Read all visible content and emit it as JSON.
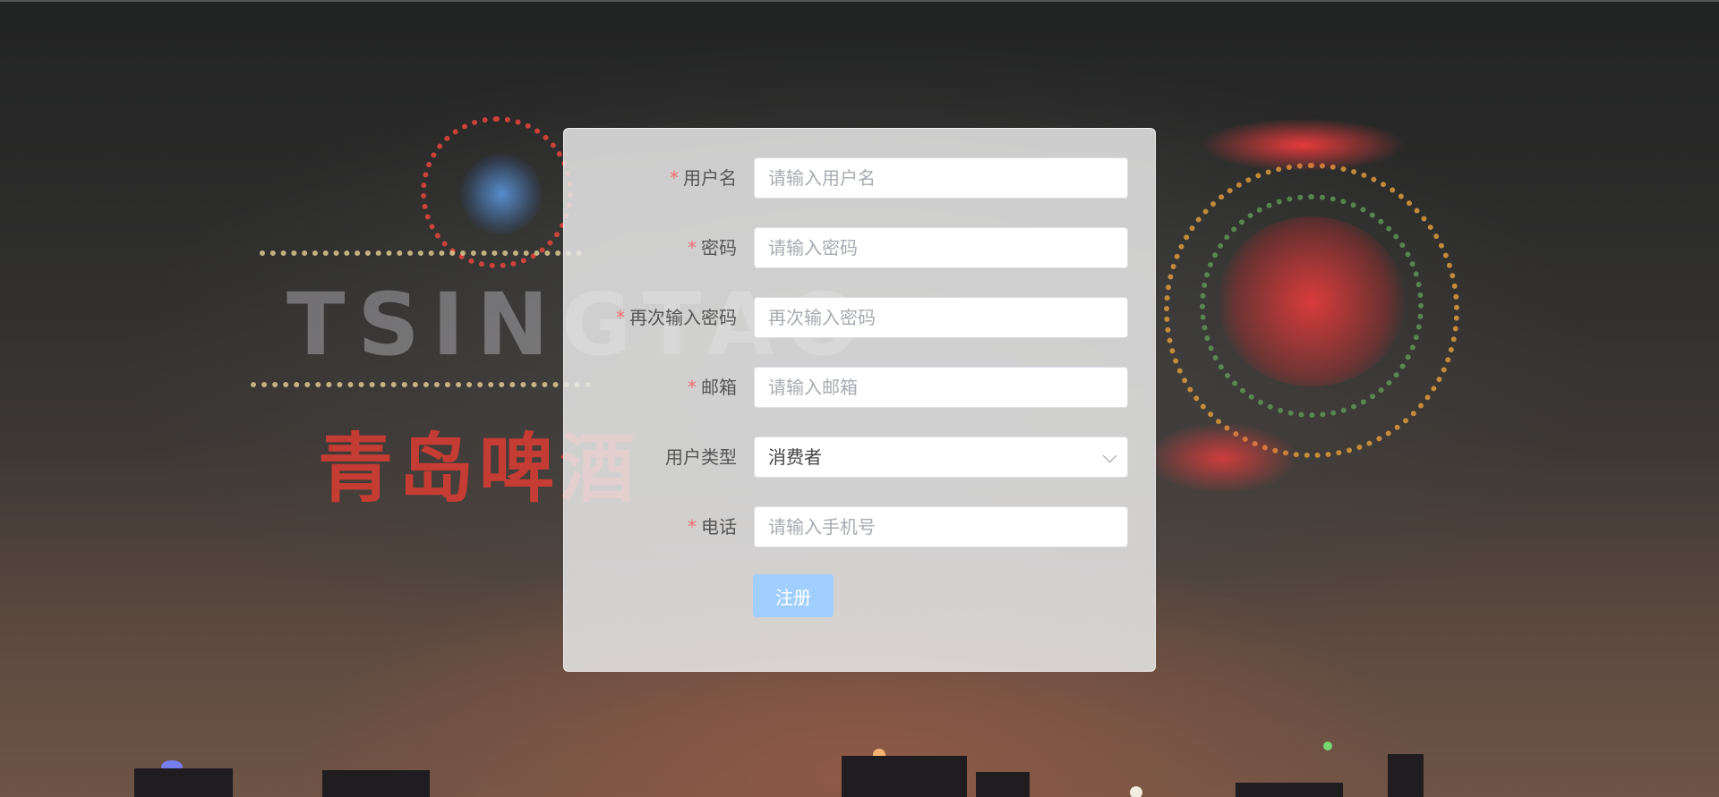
{
  "form": {
    "fields": [
      {
        "label": "用户名",
        "required": true,
        "type": "text",
        "placeholder": "请输入用户名"
      },
      {
        "label": "密码",
        "required": true,
        "type": "password",
        "placeholder": "请输入密码"
      },
      {
        "label": "再次输入密码",
        "required": true,
        "type": "password",
        "placeholder": "再次输入密码"
      },
      {
        "label": "邮箱",
        "required": true,
        "type": "text",
        "placeholder": "请输入邮箱"
      },
      {
        "label": "用户类型",
        "required": false,
        "type": "select",
        "value": "消费者",
        "icon": "chevron-down-icon"
      },
      {
        "label": "电话",
        "required": true,
        "type": "text",
        "placeholder": "请输入手机号"
      }
    ],
    "required_mark": "*",
    "submit_label": "注册"
  },
  "background": {
    "logo_text": "TSINGTAO",
    "logo_cn": "青岛啤酒"
  },
  "colors": {
    "required": "#f56c6c",
    "button": "#a0cfff",
    "card": "#e8e8e8"
  }
}
